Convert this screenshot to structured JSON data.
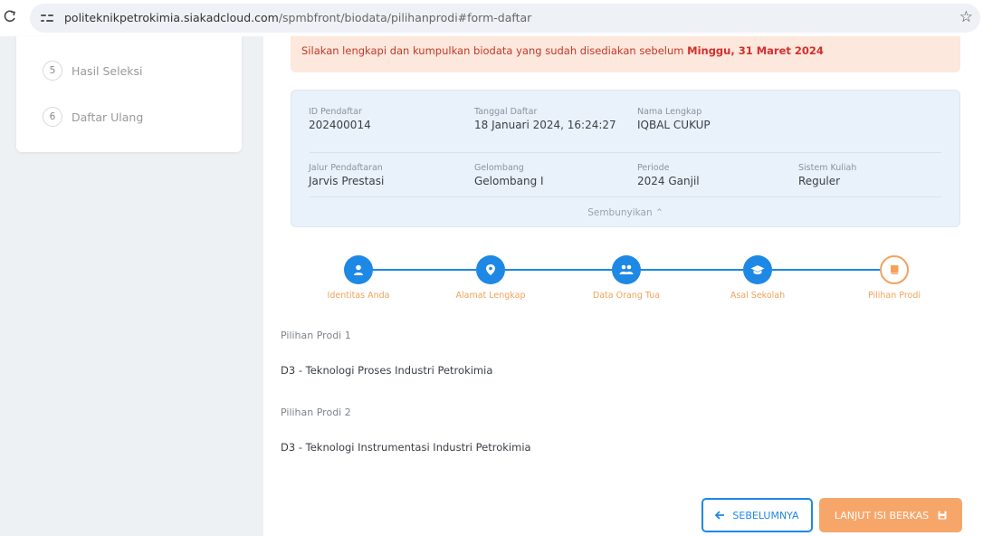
{
  "browser": {
    "url_host": "politeknikpetrokimia.siakadcloud.com",
    "url_path": "/spmbfront/biodata/pilihanprodi#form-daftar"
  },
  "sidebar": {
    "steps": [
      {
        "num": "5",
        "label": "Hasil Seleksi"
      },
      {
        "num": "6",
        "label": "Daftar Ulang"
      }
    ]
  },
  "alert": {
    "text": "Silakan lengkapi dan kumpulkan biodata yang sudah disediakan sebelum ",
    "deadline": "Minggu, 31 Maret 2024"
  },
  "info": {
    "id_label": "ID Pendaftar",
    "id_value": "202400014",
    "date_label": "Tanggal Daftar",
    "date_value": "18 Januari 2024, 16:24:27",
    "name_label": "Nama Lengkap",
    "name_value": "IQBAL CUKUP",
    "jalur_label": "Jalur Pendaftaran",
    "jalur_value": "Jarvis Prestasi",
    "gel_label": "Gelombang",
    "gel_value": "Gelombang I",
    "periode_label": "Periode",
    "periode_value": "2024 Ganjil",
    "sistem_label": "Sistem Kuliah",
    "sistem_value": "Reguler",
    "hide_link": "Sembunyikan ⌃"
  },
  "stepper": {
    "steps": [
      {
        "label": "Identitas Anda",
        "icon": "user-icon"
      },
      {
        "label": "Alamat Lengkap",
        "icon": "map-pin-icon"
      },
      {
        "label": "Data Orang Tua",
        "icon": "users-icon"
      },
      {
        "label": "Asal Sekolah",
        "icon": "graduation-cap-icon"
      },
      {
        "label": "Pilihan Prodi",
        "icon": "book-icon"
      }
    ],
    "current_index": 4
  },
  "choices": {
    "first_label": "Pilihan Prodi 1",
    "first_value": "D3 - Teknologi Proses Industri Petrokimia",
    "second_label": "Pilihan Prodi 2",
    "second_value": "D3 - Teknologi Instrumentasi Industri Petrokimia"
  },
  "buttons": {
    "prev_label": "SEBELUMNYA",
    "next_label": "LANJUT ISI BERKAS"
  },
  "colors": {
    "primary": "#1e88e5",
    "accent_orange": "#f7a66a",
    "alert_bg": "#fce8dc"
  }
}
